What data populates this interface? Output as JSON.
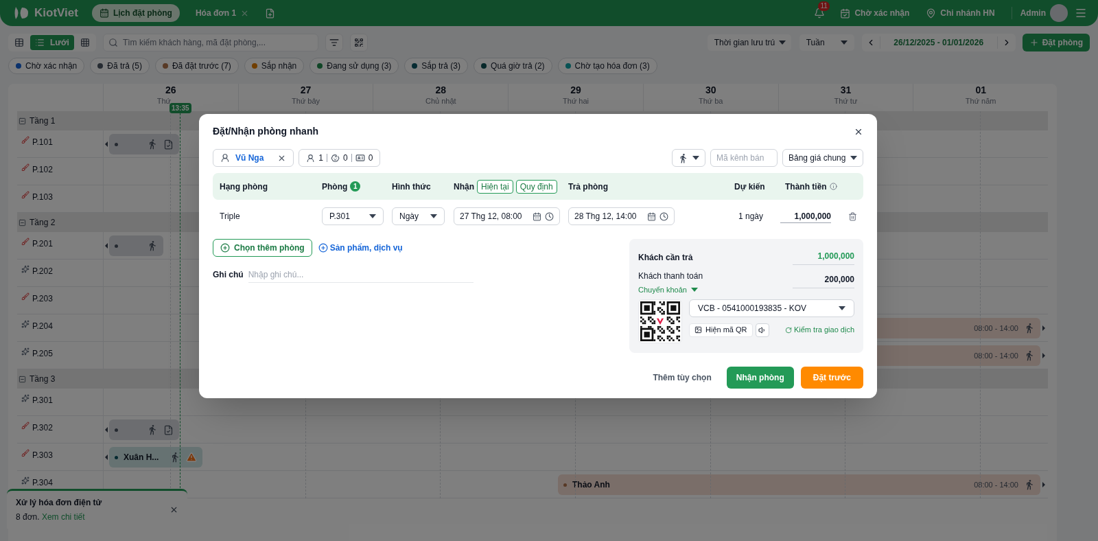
{
  "header": {
    "logo": "KiotViet",
    "tabs": [
      {
        "label": "Lịch đặt phòng",
        "selected": true,
        "closable": false
      },
      {
        "label": "Hóa đơn 1",
        "selected": false,
        "closable": true
      }
    ],
    "notifications": "11",
    "pending": "Chờ xác nhận",
    "branch": "Chi nhánh HN",
    "user": "Admin"
  },
  "toolbar": {
    "views": [
      {
        "kind": "table",
        "selected": false
      },
      {
        "kind": "list",
        "label": "Lưới",
        "selected": true
      },
      {
        "kind": "grid",
        "selected": false
      }
    ],
    "search": {
      "placeholder": "Tìm kiếm khách hàng, mã đặt phòng,..."
    },
    "time_filter": "Thời gian lưu trú",
    "period": "Tuần",
    "date_range": "26/12/2025 - 01/01/2026",
    "book_button": "Đặt phòng"
  },
  "status_chips": [
    {
      "label": "Chờ xác nhận",
      "color": "#0b326c"
    },
    {
      "label": "Đã trả (5)",
      "color": "#262b32"
    },
    {
      "label": "Đã đặt trước (7)",
      "color": "#583a26"
    },
    {
      "label": "Sắp nhận",
      "color": "#703e00"
    },
    {
      "label": "Đang sử dụng (3)",
      "color": "#104526"
    },
    {
      "label": "Sắp trả (3)",
      "color": "#062b32"
    },
    {
      "label": "Quá giờ trả (2)",
      "color": "#07282a"
    },
    {
      "label": "Chờ tạo hóa đơn (3)",
      "color": "#085254"
    }
  ],
  "calendar": {
    "days": [
      {
        "date": "26",
        "weekday": "Thứ"
      },
      {
        "date": "27",
        "weekday": "Thứ bảy"
      },
      {
        "date": "28",
        "weekday": "Chủ nhật"
      },
      {
        "date": "29",
        "weekday": "Thứ hai"
      },
      {
        "date": "30",
        "weekday": "Thứ ba"
      },
      {
        "date": "31",
        "weekday": "Thứ tư"
      },
      {
        "date": "01",
        "weekday": "Thứ năm"
      }
    ],
    "now": "13:35",
    "floors": [
      {
        "name": "Tầng 1",
        "expanded": true,
        "rooms": [
          {
            "name": "P.101",
            "kind": "dirty",
            "bookings": [
              {
                "kind": "checked_out",
                "invoice": true,
                "warning": false
              }
            ]
          },
          {
            "name": "P.102",
            "kind": "dirty"
          },
          {
            "name": "P.103",
            "kind": "dirty"
          }
        ]
      },
      {
        "name": "Tầng 2",
        "expanded": true,
        "rooms": [
          {
            "name": "P.201",
            "kind": "dirty",
            "bookings": [
              {
                "kind": "checked_out",
                "invoice": false,
                "warning": false
              }
            ]
          },
          {
            "name": "P.202",
            "kind": "clean"
          },
          {
            "name": "P.203",
            "kind": "dirty"
          },
          {
            "name": "P.204",
            "kind": "clean",
            "bookings": [
              {
                "kind": "reserved",
                "time": "08:00 - 14:00",
                "invoice": false,
                "warning": false
              }
            ]
          },
          {
            "name": "P.205",
            "kind": "clean",
            "bookings": [
              {
                "kind": "reserved",
                "time": "08:00 - 14:00",
                "invoice": false,
                "warning": false
              }
            ]
          }
        ]
      },
      {
        "name": "Tầng 3",
        "expanded": true,
        "rooms": [
          {
            "name": "P.301",
            "kind": "clean"
          },
          {
            "name": "P.302",
            "kind": "dirty",
            "bookings": [
              {
                "kind": "checked_out",
                "invoice": true,
                "warning": false
              }
            ]
          },
          {
            "name": "P.303",
            "kind": "dirty",
            "bookings": [
              {
                "kind": "in_use",
                "guest": "Xuân H...",
                "invoice": false,
                "warning": true
              }
            ]
          },
          {
            "name": "P.304",
            "kind": "clean",
            "bookings": [
              {
                "kind": "reserved",
                "guest": "Thảo Anh",
                "time": "08:00 - 14:00",
                "invoice": false,
                "warning": false
              }
            ]
          }
        ]
      }
    ]
  },
  "toast": {
    "title": "Xử lý hóa đơn điện tử",
    "count": "8 đơn.",
    "link": "Xem chi tiết"
  },
  "dialog": {
    "title": "Đặt/Nhận phòng nhanh",
    "customer": "Vũ Nga",
    "adults": "1",
    "children": "0",
    "ids": "0",
    "channel_placeholder": "Mã kênh bán",
    "price_list": "Bảng giá chung",
    "columns": [
      "Hạng phòng",
      "Phòng",
      "Hình thức",
      "Nhận",
      "Trả phòng",
      "Dự kiến",
      "Thành tiền"
    ],
    "room_count": "1",
    "checkin_options": [
      "Hiện tại",
      "Quy định"
    ],
    "rows": [
      {
        "room_type": "Triple",
        "room": "P.301",
        "mode": "Ngày",
        "check_in": "27 Thg 12, 08:00",
        "check_out": "28 Thg 12, 14:00",
        "duration": "1 ngày",
        "amount": "1,000,000"
      }
    ],
    "add_room": "Chọn thêm phòng",
    "add_service": "Sản phẩm, dịch vụ",
    "note_label": "Ghi chú",
    "note_placeholder": "Nhập ghi chú...",
    "payment": {
      "due_label": "Khách cần trả",
      "due": "1,000,000",
      "paid_label": "Khách thanh toán",
      "paid": "200,000",
      "method": "Chuyển khoản",
      "account": "VCB - 0541000193835 - KOV",
      "show_qr": "Hiện mã QR",
      "check": "Kiểm tra giao dịch"
    },
    "more": "Thêm tùy chọn",
    "check_in_button": "Nhận phòng",
    "reserve_button": "Đặt trước"
  }
}
